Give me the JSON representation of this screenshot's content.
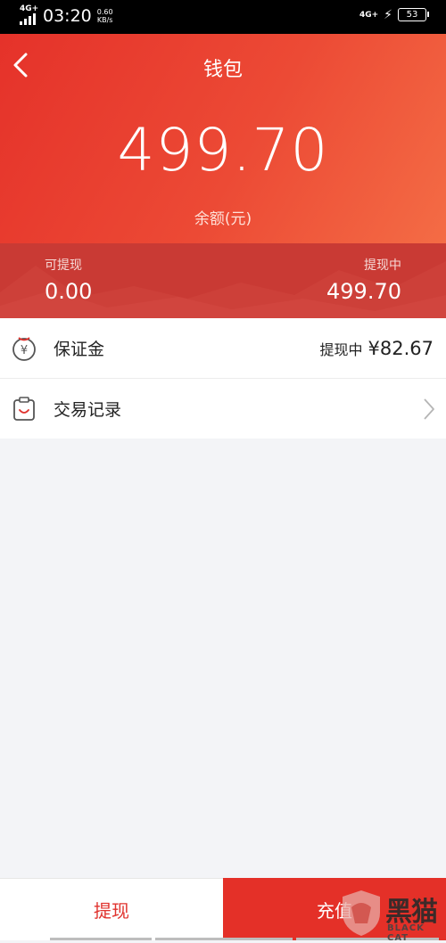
{
  "status_bar": {
    "network_left": "4G+",
    "time": "03:20",
    "speed_value": "0.60",
    "speed_unit": "KB/s",
    "network_right": "4G+",
    "battery": "53"
  },
  "header": {
    "back_icon": "chevron-left-icon",
    "title": "钱包",
    "balance": "499.70",
    "balance_label": "余额(元)"
  },
  "summary": {
    "withdrawable_label": "可提现",
    "withdrawable_value": "0.00",
    "withdrawing_label": "提现中",
    "withdrawing_value": "499.70"
  },
  "list": {
    "deposit": {
      "icon": "yuan-coin-icon",
      "label": "保证金",
      "status": "提现中",
      "amount": "¥82.67"
    },
    "records": {
      "icon": "clipboard-icon",
      "label": "交易记录",
      "chevron": "chevron-right-icon"
    }
  },
  "bottom_bar": {
    "withdraw_label": "提现",
    "recharge_label": "充值"
  },
  "watermark": {
    "text": "黑猫",
    "sub": "BLACK CAT"
  },
  "colors": {
    "brand_red": "#e43028",
    "header_gradient_end": "#f46c45",
    "band": "#c93a34"
  }
}
